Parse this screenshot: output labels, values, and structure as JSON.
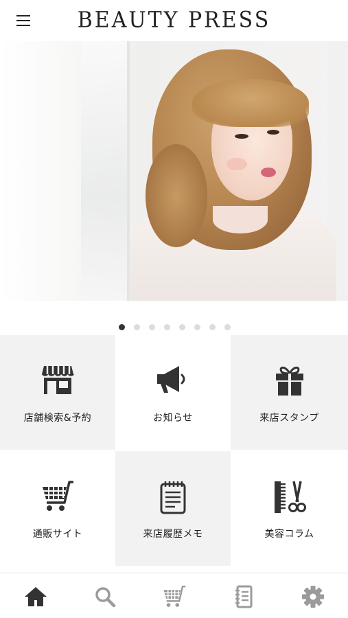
{
  "app": {
    "title": "BEAUTY PRESS"
  },
  "header": {
    "menu_icon": "hamburger-menu-icon"
  },
  "carousel": {
    "slide_count": 8,
    "active_index": 0,
    "hero_image": "woman-portrait-photo"
  },
  "menu_tiles": [
    {
      "label": "店舗検索&予約",
      "icon": "storefront-icon"
    },
    {
      "label": "お知らせ",
      "icon": "megaphone-icon"
    },
    {
      "label": "来店スタンプ",
      "icon": "gift-icon"
    },
    {
      "label": "通販サイト",
      "icon": "cart-icon"
    },
    {
      "label": "来店履歴メモ",
      "icon": "notepad-icon"
    },
    {
      "label": "美容コラム",
      "icon": "comb-scissors-icon"
    }
  ],
  "bottom_nav": [
    {
      "name": "home",
      "icon": "home-icon",
      "active": true
    },
    {
      "name": "search",
      "icon": "search-icon",
      "active": false
    },
    {
      "name": "cart",
      "icon": "cart-icon",
      "active": false
    },
    {
      "name": "memo",
      "icon": "notebook-icon",
      "active": false
    },
    {
      "name": "settings",
      "icon": "gear-icon",
      "active": false
    }
  ],
  "colors": {
    "icon_dark": "#333333",
    "icon_inactive": "#9b9b9b",
    "tile_gray": "#f2f2f2",
    "dot_active": "#333333",
    "dot_inactive": "#dcdcdc"
  }
}
